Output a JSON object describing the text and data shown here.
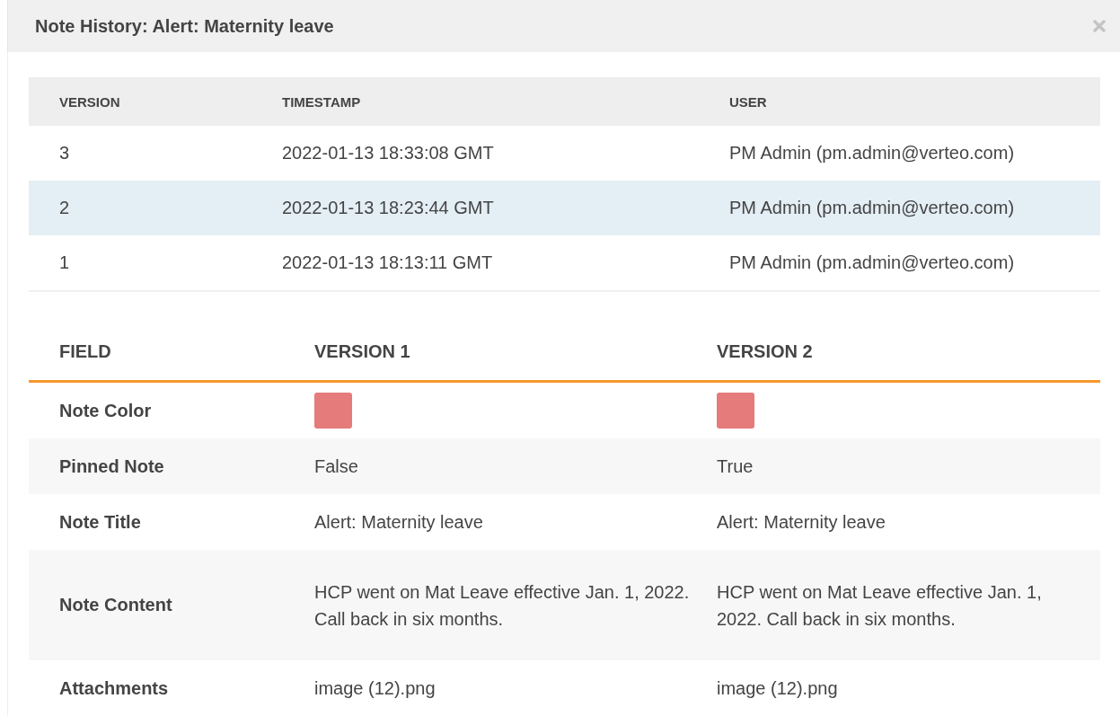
{
  "dialog": {
    "title": "Note History: Alert: Maternity leave"
  },
  "versions": {
    "columns": [
      "VERSION",
      "TIMESTAMP",
      "USER"
    ],
    "rows": [
      {
        "cells": [
          "3",
          "2022-01-13 18:33:08 GMT",
          "PM Admin (pm.admin@verteo.com)"
        ],
        "selected": false
      },
      {
        "cells": [
          "2",
          "2022-01-13 18:23:44 GMT",
          "PM Admin (pm.admin@verteo.com)"
        ],
        "selected": true
      },
      {
        "cells": [
          "1",
          "2022-01-13 18:13:11 GMT",
          "PM Admin (pm.admin@verteo.com)"
        ],
        "selected": false
      }
    ]
  },
  "comparison": {
    "columns": [
      "FIELD",
      "VERSION 1",
      "VERSION 2"
    ],
    "rows": [
      {
        "field": "Note Color",
        "values": [
          {
            "kind": "swatch",
            "color": "#e57b7b"
          },
          {
            "kind": "swatch",
            "color": "#e57b7b"
          }
        ]
      },
      {
        "field": "Pinned Note",
        "values": [
          {
            "kind": "text",
            "text": "False"
          },
          {
            "kind": "text",
            "text": "True"
          }
        ]
      },
      {
        "field": "Note Title",
        "values": [
          {
            "kind": "text",
            "text": "Alert: Maternity leave"
          },
          {
            "kind": "text",
            "text": "Alert: Maternity leave"
          }
        ]
      },
      {
        "field": "Note Content",
        "values": [
          {
            "kind": "text",
            "text": "HCP went on Mat Leave effective Jan. 1, 2022. Call back in six months."
          },
          {
            "kind": "text",
            "text": "HCP went on Mat Leave effective Jan. 1, 2022. Call back in six months."
          }
        ]
      },
      {
        "field": "Attachments",
        "values": [
          {
            "kind": "text",
            "text": "image (12).png"
          },
          {
            "kind": "text",
            "text": "image (12).png"
          }
        ]
      }
    ]
  }
}
